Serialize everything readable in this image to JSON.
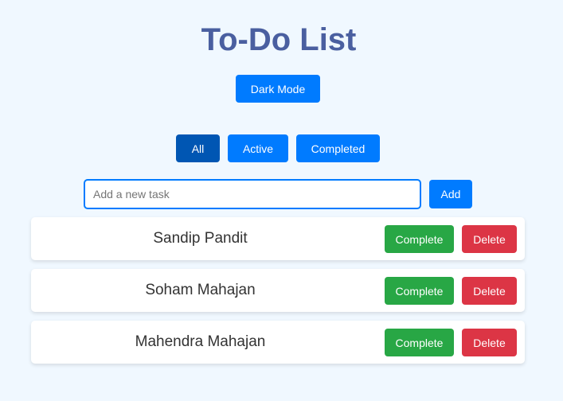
{
  "header": {
    "title": "To-Do List",
    "dark_mode_label": "Dark Mode"
  },
  "filters": {
    "all": "All",
    "active": "Active",
    "completed": "Completed",
    "selected": "All"
  },
  "new_task": {
    "placeholder": "Add a new task",
    "value": "",
    "add_label": "Add"
  },
  "tasks": [
    {
      "text": "Sandip Pandit",
      "complete_label": "Complete",
      "delete_label": "Delete"
    },
    {
      "text": "Soham Mahajan",
      "complete_label": "Complete",
      "delete_label": "Delete"
    },
    {
      "text": "Mahendra Mahajan",
      "complete_label": "Complete",
      "delete_label": "Delete"
    }
  ],
  "colors": {
    "background": "#f0f8ff",
    "title": "#4a5fa0",
    "primary": "#007bff",
    "primary_active": "#0056b3",
    "complete": "#28a745",
    "delete": "#dc3545"
  }
}
